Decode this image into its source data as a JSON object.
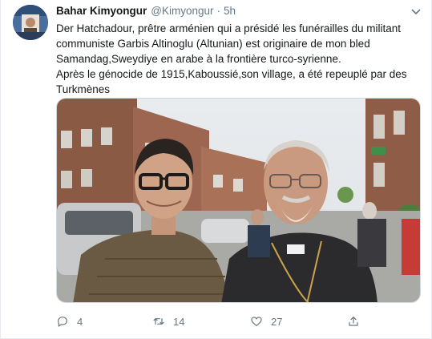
{
  "tweet": {
    "author_name": "Bahar Kimyongur",
    "author_handle": "@Kimyongur",
    "separator": "·",
    "time": "5h",
    "text_lines": [
      "Der Hatchadour, prêtre arménien qui a présidé les funérailles du militant communiste Garbis Altinoglu (Altunian) est originaire de mon bled Samandag,Sweydiye en arabe à la frontière turco-syrienne.",
      "Après le génocide de 1915,Kaboussié,son village, a été repeuplé par des Turkmènes"
    ],
    "actions": {
      "reply_count": "4",
      "retweet_count": "14",
      "like_count": "27"
    }
  },
  "icons": {
    "more": "chevron-down-icon",
    "reply": "reply-icon",
    "retweet": "retweet-icon",
    "like": "heart-icon",
    "share": "share-icon"
  },
  "colors": {
    "text": "#14171a",
    "secondary": "#657786",
    "border": "#e6ecf0"
  }
}
